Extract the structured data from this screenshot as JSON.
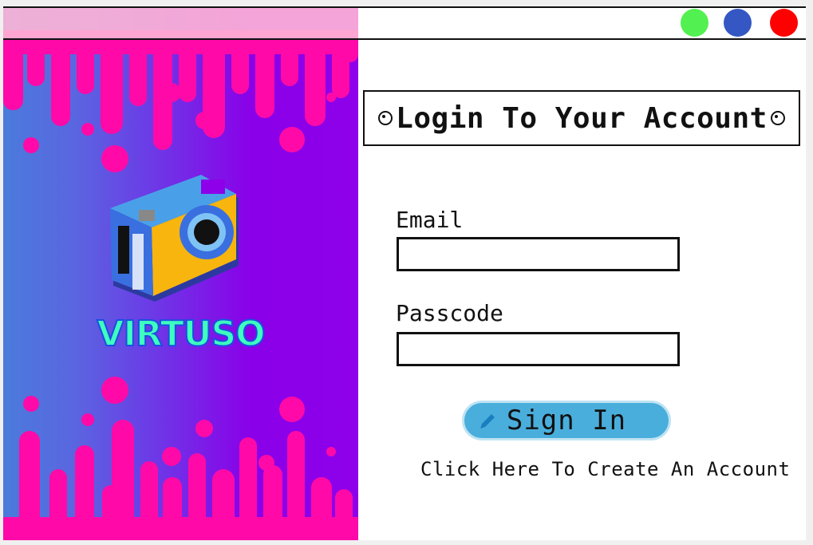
{
  "window": {
    "controls": [
      {
        "name": "maximize",
        "color": "#52f050"
      },
      {
        "name": "minimize",
        "color": "#3457c4"
      },
      {
        "name": "close",
        "color": "#ff0000"
      }
    ]
  },
  "brand": {
    "name": "VIRTUSO"
  },
  "login": {
    "heading": "Login To Your Account",
    "email_label": "Email",
    "email_value": "",
    "passcode_label": "Passcode",
    "passcode_value": "",
    "signin_label": "Sign In",
    "create_account_link": "Click Here To Create An Account"
  },
  "colors": {
    "pink": "#ff00aa",
    "purple": "#8e00ea",
    "blue": "#4a7bdc",
    "button": "#4aaedc"
  }
}
